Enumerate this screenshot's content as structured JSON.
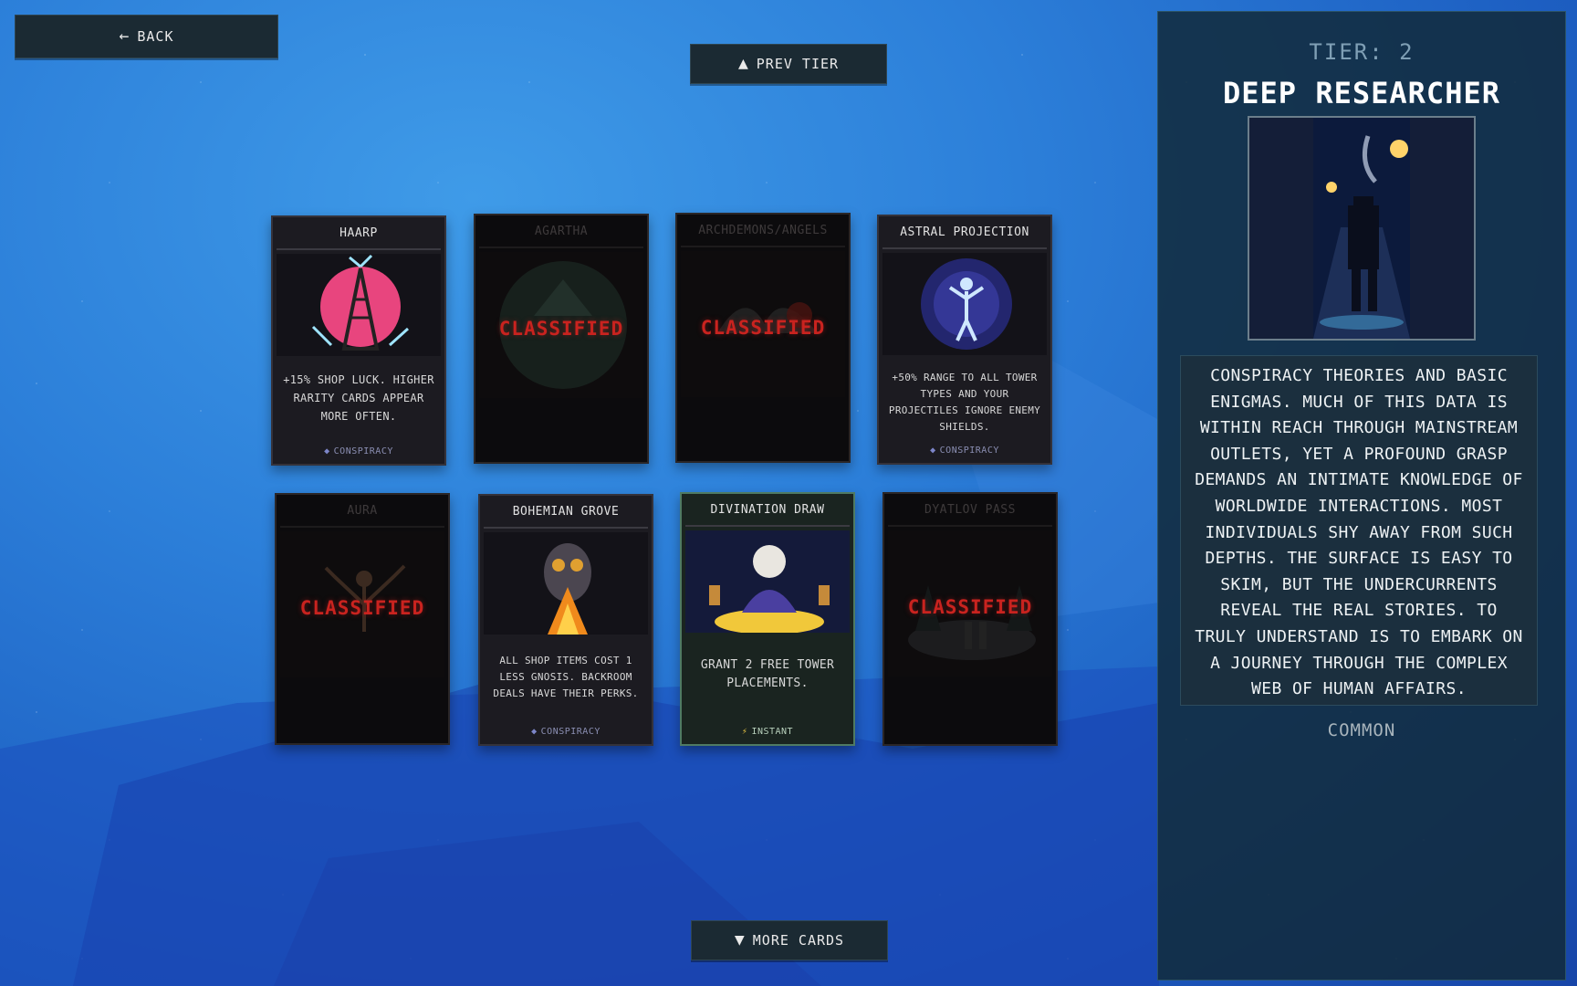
{
  "nav": {
    "back_label": "BACK",
    "prev_tier_label": "PREV TIER",
    "more_cards_label": "MORE CARDS"
  },
  "cards": [
    {
      "title": "HAARP",
      "state": "unlocked",
      "description": "+15% SHOP LUCK. HIGHER RARITY CARDS APPEAR MORE OFTEN.",
      "tag": "CONSPIRACY",
      "tag_icon": "diamond-icon"
    },
    {
      "title": "AGARTHA",
      "state": "locked",
      "overlay": "CLASSIFIED"
    },
    {
      "title": "ARCHDEMONS/ANGELS",
      "state": "locked",
      "overlay": "CLASSIFIED"
    },
    {
      "title": "ASTRAL PROJECTION",
      "state": "unlocked",
      "description": "+50% RANGE TO ALL TOWER TYPES AND YOUR PROJECTILES IGNORE ENEMY SHIELDS.",
      "tag": "CONSPIRACY",
      "tag_icon": "diamond-icon"
    },
    {
      "title": "AURA",
      "state": "locked",
      "overlay": "CLASSIFIED"
    },
    {
      "title": "BOHEMIAN GROVE",
      "state": "unlocked",
      "description": "ALL SHOP ITEMS COST 1 LESS GNOSIS. BACKROOM DEALS HAVE THEIR PERKS.",
      "tag": "CONSPIRACY",
      "tag_icon": "diamond-icon"
    },
    {
      "title": "DIVINATION DRAW",
      "state": "instant",
      "description": "GRANT 2 FREE TOWER PLACEMENTS.",
      "tag": "INSTANT",
      "tag_icon": "lightning-icon"
    },
    {
      "title": "DYATLOV PASS",
      "state": "locked",
      "overlay": "CLASSIFIED"
    }
  ],
  "detail": {
    "tier": "TIER: 2",
    "name": "DEEP RESEARCHER",
    "description": "CONSPIRACY THEORIES AND BASIC ENIGMAS. MUCH OF THIS DATA IS WITHIN REACH THROUGH MAINSTREAM OUTLETS, YET A PROFOUND GRASP DEMANDS AN INTIMATE KNOWLEDGE OF WORLDWIDE INTERACTIONS. MOST INDIVIDUALS SHY AWAY FROM SUCH DEPTHS. THE SURFACE IS EASY TO SKIM, BUT THE UNDERCURRENTS REVEAL THE REAL STORIES. TO TRULY UNDERSTAND IS TO EMBARK ON A JOURNEY THROUGH THE COMPLEX WEB OF HUMAN AFFAIRS.",
    "rarity": "COMMON"
  },
  "colors": {
    "classified_red": "#c9231f",
    "panel_bg": "#122a3a",
    "button_bg": "#1b2a33"
  }
}
